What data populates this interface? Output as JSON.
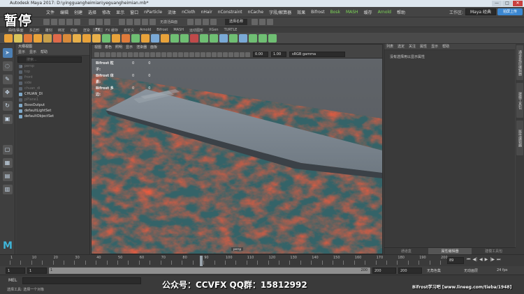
{
  "window": {
    "title": "Autodesk Maya 2017: D:\\yingguangheimian\\yeguangheimian.mb*",
    "controls": [
      "—",
      "□",
      "✕"
    ]
  },
  "overlay": {
    "pause_text": "暂停",
    "watermark_center": "公众号：CCVFX QQ群：15812992",
    "watermark_right": "Bifrost学习吧 [www.lineeg.com/tieba/1948]"
  },
  "menubar": {
    "items": [
      "文件",
      "编辑",
      "创建",
      "选择",
      "修改",
      "显示",
      "窗口",
      "nParticle",
      "流体",
      "nCloth",
      "nHair",
      "nConstraint",
      "nCache",
      "字段/解算器",
      "效果",
      "Bifrost",
      "Bosk",
      "MASH",
      "缓存",
      "Arnold",
      "帮助"
    ],
    "highlighted": [
      "Bosk",
      "MASH",
      "Arnold"
    ],
    "workspace_label": "工作区:",
    "workspace_value": "Maya 经典",
    "upload_label": "拍屏上传"
  },
  "status_line": {
    "mode": "FX",
    "snap_text": "无激活曲面",
    "quick_select": "选择名称"
  },
  "shelf": {
    "tabs": [
      "曲线/曲面",
      "多边形",
      "雕刻",
      "绑定",
      "动画",
      "渲染",
      "FX",
      "FX 缓存",
      "自定义",
      "Arnold",
      "Bifrost",
      "MASH",
      "运动图形",
      "XGen",
      "TURTLE"
    ],
    "active_tab": "FX",
    "icon_colors": [
      "#e8a23a",
      "#d9c45a",
      "#e07b3a",
      "#e8a23a",
      "#c9a04a",
      "#e06a4a",
      "#d98a3a",
      "#e8b04a",
      "#e8a23a",
      "#e8b04a",
      "#6fbf73",
      "#e8a23a",
      "#e07b3a",
      "#6fbf73",
      "#e8a23a",
      "#7aa9d6",
      "#e8a23a",
      "#6fbf73",
      "#6fbf73",
      "#c04a4a",
      "#6fbf73",
      "#6fbf73",
      "#7aa9d6",
      "#6fbf73",
      "#7aa9d6",
      "#6fbf73",
      "#6fbf73",
      "#6fbf73"
    ]
  },
  "outliner": {
    "title": "大纲视图",
    "menu": [
      "显示",
      "显示",
      "帮助"
    ],
    "search_placeholder": "搜索...",
    "items": [
      {
        "label": "persp",
        "dim": true
      },
      {
        "label": "top",
        "dim": true
      },
      {
        "label": "front",
        "dim": true
      },
      {
        "label": "side",
        "dim": true
      },
      {
        "label": "chuan_di",
        "dim": true
      },
      {
        "label": "CHUAN_DI",
        "dim": false
      },
      {
        "label": "pPlane1",
        "dim": true
      },
      {
        "label": "BossOutput",
        "dim": false
      },
      {
        "label": "defaultLightSet",
        "dim": false
      },
      {
        "label": "defaultObjectSet",
        "dim": false
      }
    ]
  },
  "viewport": {
    "menu": [
      "视图",
      "着色",
      "照明",
      "显示",
      "渲染器",
      "面板"
    ],
    "field1": "0.00",
    "field2": "1.00",
    "colorspace": "sRGB gamma",
    "hud": [
      {
        "label": "Bifrost 粒子:",
        "v1": "0",
        "v2": "0"
      },
      {
        "label": "Bifrost 体素:",
        "v1": "0",
        "v2": "0"
      },
      {
        "label": "Bifrost 多边:",
        "v1": "0",
        "v2": "0"
      }
    ],
    "camera": "persp"
  },
  "attribute_editor": {
    "menu": [
      "列表",
      "选定",
      "关注",
      "属性",
      "显示",
      "帮助"
    ],
    "message": "没有选择用以显示属性",
    "tabs": [
      "通道盒",
      "属性编辑器",
      "建模工具包"
    ],
    "active_tab": "属性编辑器",
    "side_tabs": [
      "通道盒/层编辑器",
      "建模工具包",
      "属性编辑器"
    ]
  },
  "time_slider": {
    "ticks": [
      "1",
      "5",
      "10",
      "15",
      "20",
      "25",
      "30",
      "35",
      "40",
      "45",
      "50",
      "55",
      "60",
      "65",
      "70",
      "75",
      "80",
      "85",
      "90",
      "95",
      "100",
      "105",
      "110",
      "115",
      "120",
      "125",
      "130",
      "135",
      "140",
      "145",
      "150",
      "155",
      "160",
      "165",
      "170",
      "175",
      "180",
      "185",
      "190",
      "195",
      "200"
    ],
    "current_frame": "89"
  },
  "range_slider": {
    "start": "1",
    "start_inner": "1",
    "range_start_label": "1",
    "range_end_label": "200",
    "end_inner": "200",
    "end": "200",
    "char_set": "无角色集",
    "anim_layer": "无动画层",
    "fps": "24 fps"
  },
  "mel": {
    "label": "MEL"
  },
  "help_line": {
    "text": "选择工具: 选择一个对象"
  }
}
